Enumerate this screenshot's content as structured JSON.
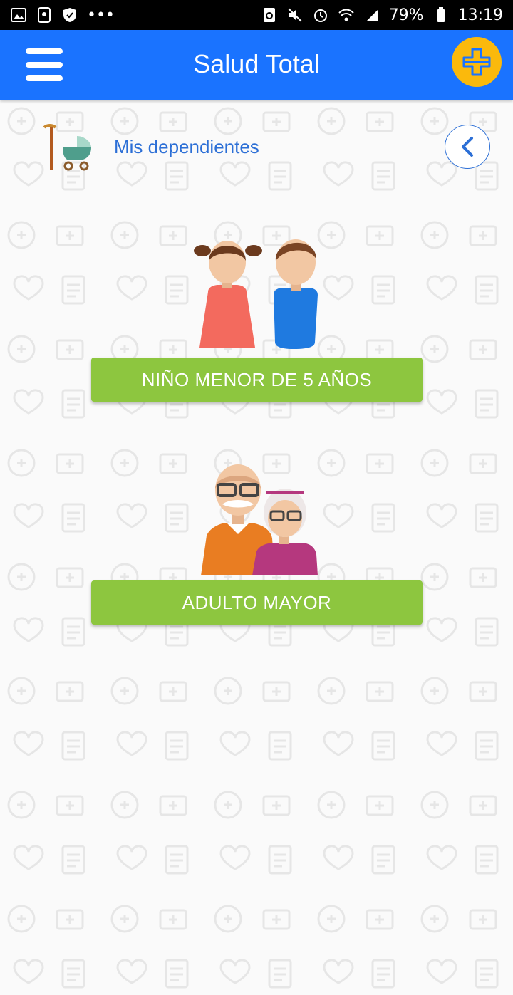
{
  "status_bar": {
    "battery": "79%",
    "time": "13:19",
    "dots": "•••"
  },
  "app_bar": {
    "title": "Salud Total"
  },
  "section": {
    "title": "Mis dependientes"
  },
  "categories": [
    {
      "label": "NIÑO MENOR DE 5 AÑOS"
    },
    {
      "label": "ADULTO MAYOR"
    }
  ],
  "colors": {
    "brand_blue": "#1a73ff",
    "accent_yellow": "#fbb90c",
    "button_green": "#8dc63f",
    "link_blue": "#2c6fd6"
  }
}
